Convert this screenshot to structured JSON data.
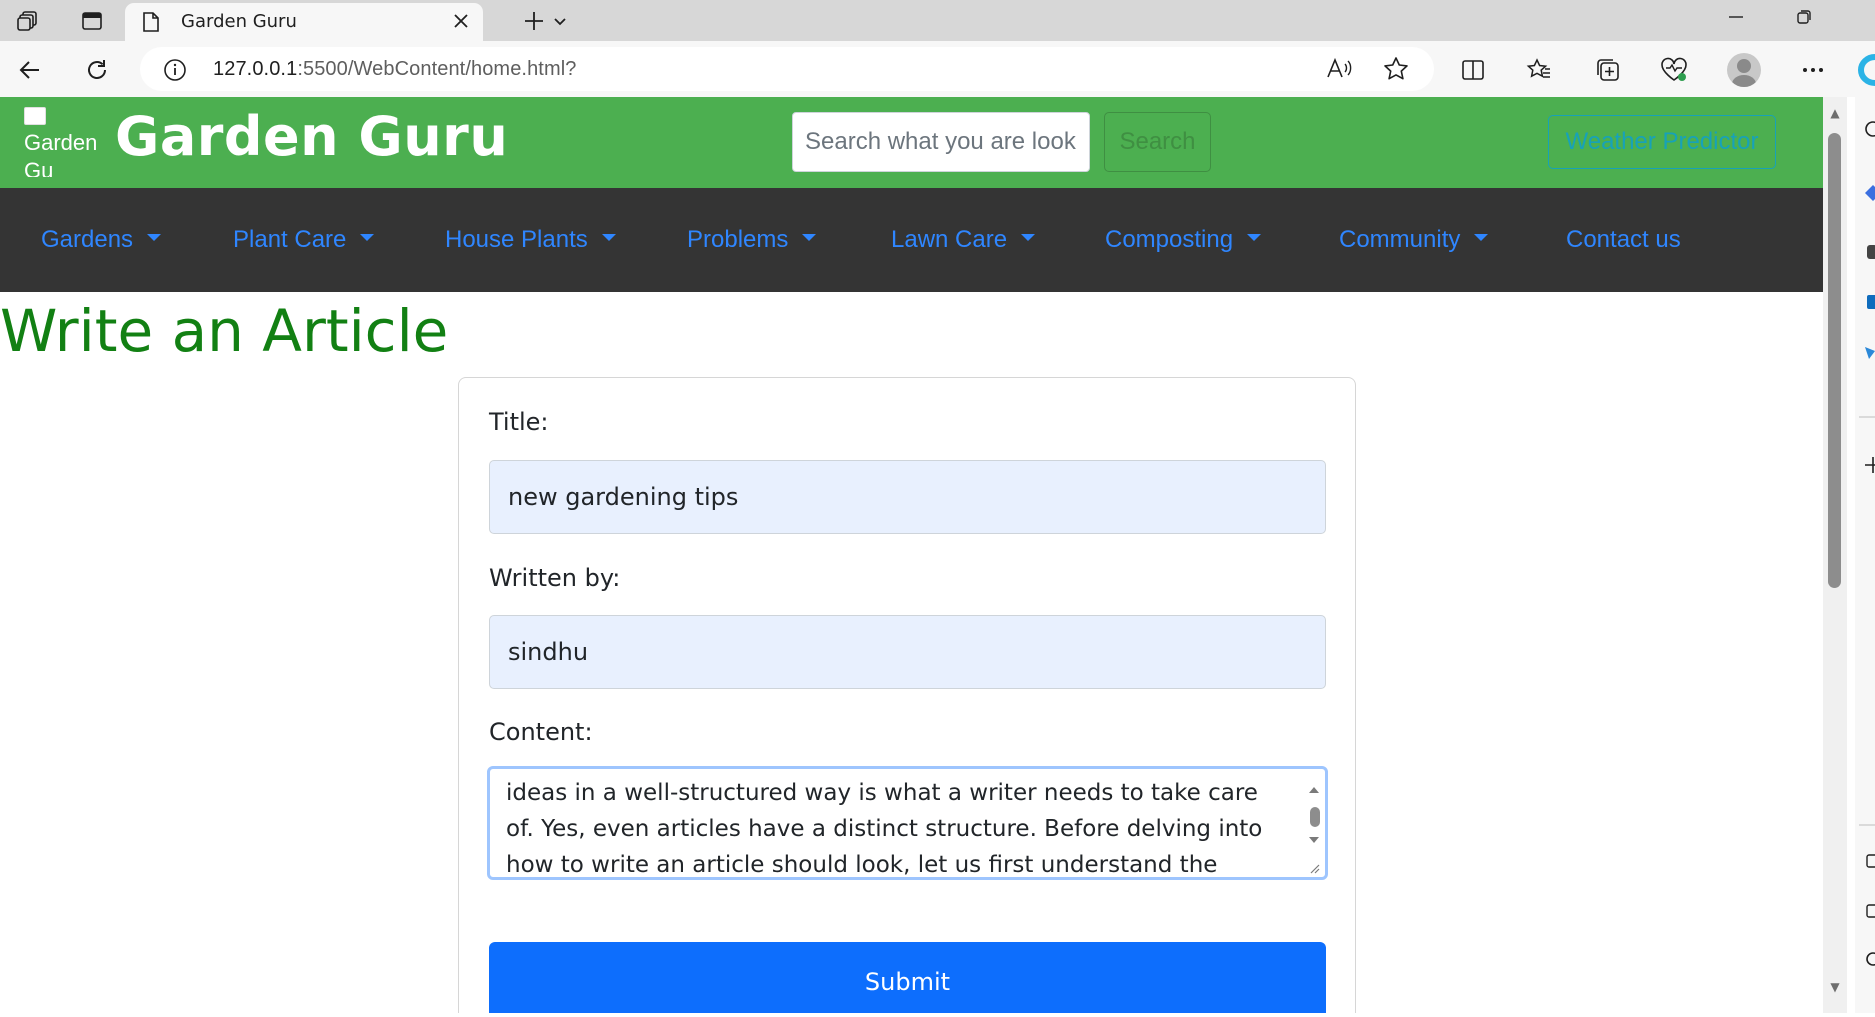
{
  "browser": {
    "tab_title": "Garden Guru",
    "address_host": "127.0.0.1",
    "address_rest": ":5500/WebContent/home.html?"
  },
  "header": {
    "logo_alt": "Garden Gu",
    "brand": "Garden Guru",
    "search_placeholder": "Search what you are looking for",
    "search_button": "Search",
    "weather_button": "Weather Predictor"
  },
  "menu": {
    "items": [
      {
        "label": "Gardens",
        "dropdown": true
      },
      {
        "label": "Plant Care",
        "dropdown": true
      },
      {
        "label": "House Plants",
        "dropdown": true
      },
      {
        "label": "Problems",
        "dropdown": true
      },
      {
        "label": "Lawn Care",
        "dropdown": true
      },
      {
        "label": "Composting",
        "dropdown": true
      },
      {
        "label": "Community",
        "dropdown": true
      },
      {
        "label": "Contact us",
        "dropdown": false
      }
    ]
  },
  "page": {
    "title": "Write an Article"
  },
  "form": {
    "title_label": "Title:",
    "title_value": "new gardening tips",
    "author_label": "Written by:",
    "author_value": "sindhu",
    "content_label": "Content:",
    "content_value": "ideas in a well-structured way is what a writer needs to take care of. Yes, even articles have a distinct structure. Before delving into how to write an article should look, let us first understand the basics of it.",
    "submit_label": "Submit"
  },
  "colors": {
    "header_green": "#4caf50",
    "menu_dark": "#343434",
    "link_blue": "#2f86ff",
    "title_green": "#128013",
    "submit_blue": "#0d6efd",
    "weather_teal": "#17a2b8"
  }
}
